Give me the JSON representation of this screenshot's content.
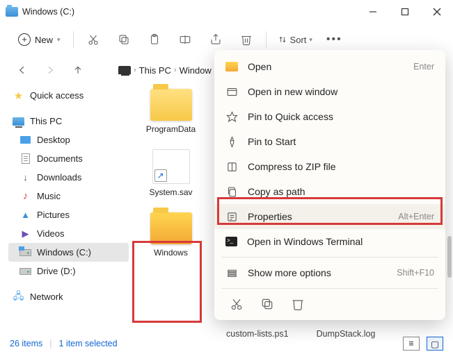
{
  "titlebar": {
    "title": "Windows (C:)"
  },
  "toolbar": {
    "new_label": "New",
    "sort_label": "Sort"
  },
  "breadcrumb": {
    "seg1": "This PC",
    "seg2": "Window"
  },
  "sidebar": {
    "quick": "Quick access",
    "thispc": "This PC",
    "desktop": "Desktop",
    "documents": "Documents",
    "downloads": "Downloads",
    "music": "Music",
    "pictures": "Pictures",
    "videos": "Videos",
    "cdrive": "Windows (C:)",
    "ddrive": "Drive (D:)",
    "network": "Network"
  },
  "items": {
    "programdata": "ProgramData",
    "systemsav": "System.sav",
    "windows": "Windows"
  },
  "ctx": {
    "open": "Open",
    "open_sc": "Enter",
    "newwin": "Open in new window",
    "pinquick": "Pin to Quick access",
    "pinstart": "Pin to Start",
    "zip": "Compress to ZIP file",
    "copypath": "Copy as path",
    "props": "Properties",
    "props_sc": "Alt+Enter",
    "terminal": "Open in Windows Terminal",
    "more": "Show more options",
    "more_sc": "Shift+F10"
  },
  "status": {
    "count": "26 items",
    "selected": "1 item selected"
  },
  "files": {
    "f1": "custom-lists.ps1",
    "f2": "DumpStack.log"
  }
}
